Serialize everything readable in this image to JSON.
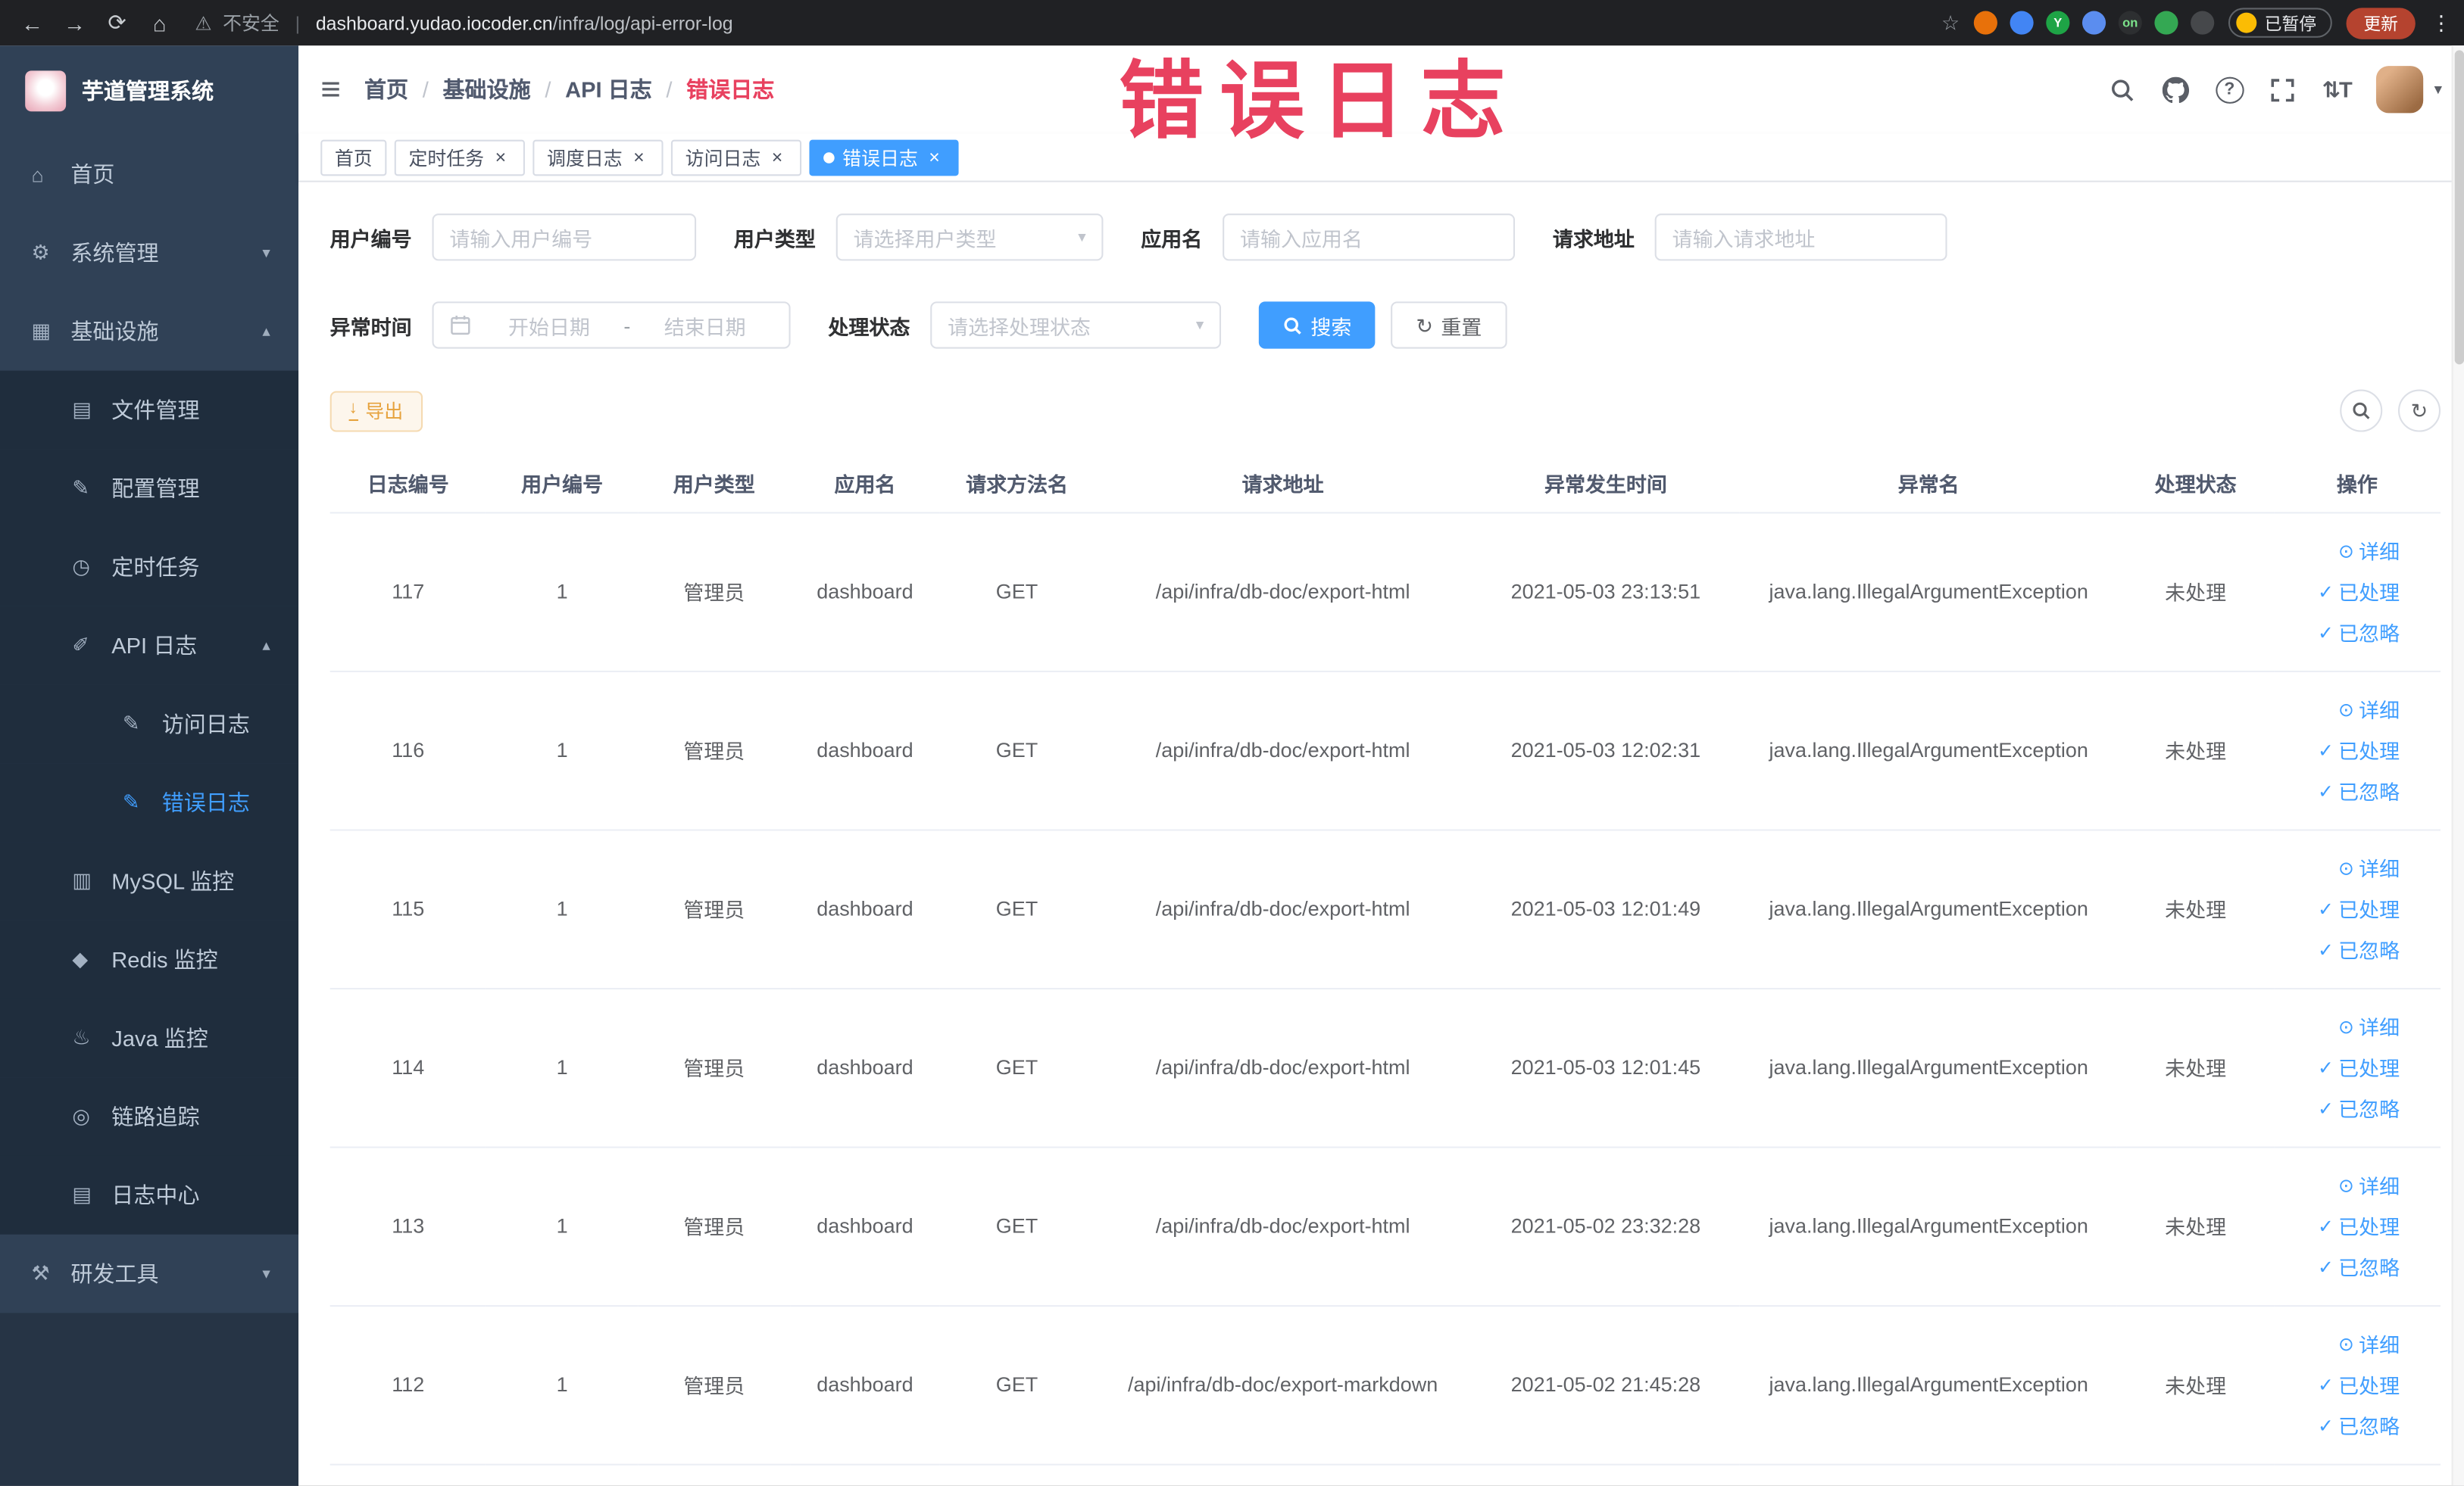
{
  "accent_color": "#409eff",
  "annotation": {
    "text": "错误日志",
    "color": "#e8415f"
  },
  "browser": {
    "security_warning": "不安全",
    "url_domain": "dashboard.yudao.iocoder.cn",
    "url_path": "/infra/log/api-error-log",
    "paused_badge": "已暂停",
    "update_button": "更新",
    "update_button_color": "#b5432f",
    "extensions": [
      {
        "name": "extension-orange-icon",
        "bg": "#e8710a",
        "label": ""
      },
      {
        "name": "extension-blue-icon",
        "bg": "#4285f4",
        "label": ""
      },
      {
        "name": "extension-green-y-icon",
        "bg": "#1ea446",
        "label": "Y"
      },
      {
        "name": "extension-grid-icon",
        "bg": "#5b8def",
        "label": ""
      },
      {
        "name": "extension-on-icon",
        "bg": "#2d2f31",
        "label": "on",
        "label_color": "#7ce38b"
      },
      {
        "name": "extension-leaf-icon",
        "bg": "#34a853",
        "label": ""
      },
      {
        "name": "extension-paw-icon",
        "bg": "#46484b",
        "label": ""
      }
    ]
  },
  "sidebar": {
    "logo_title": "芋道管理系统",
    "items": [
      {
        "id": "home",
        "label": "首页",
        "icon": "home-icon",
        "level": 1
      },
      {
        "id": "system",
        "label": "系统管理",
        "icon": "gear-icon",
        "level": 1,
        "chevron": "down"
      },
      {
        "id": "infra",
        "label": "基础设施",
        "icon": "infra-icon",
        "level": 1,
        "chevron": "up"
      },
      {
        "id": "file",
        "label": "文件管理",
        "icon": "file-icon",
        "level": 2,
        "sub": true
      },
      {
        "id": "config",
        "label": "配置管理",
        "icon": "config-icon",
        "level": 2,
        "sub": true
      },
      {
        "id": "job",
        "label": "定时任务",
        "icon": "timer-icon",
        "level": 2,
        "sub": true
      },
      {
        "id": "api-log",
        "label": "API 日志",
        "icon": "api-log-icon",
        "level": 2,
        "sub": true,
        "chevron": "up"
      },
      {
        "id": "access-log",
        "label": "访问日志",
        "icon": "access-log-icon",
        "level": 3,
        "sub": true
      },
      {
        "id": "error-log",
        "label": "错误日志",
        "icon": "error-log-icon",
        "level": 3,
        "sub": true,
        "active": true
      },
      {
        "id": "mysql",
        "label": "MySQL 监控",
        "icon": "mysql-icon",
        "level": 2,
        "sub": true
      },
      {
        "id": "redis",
        "label": "Redis 监控",
        "icon": "redis-icon",
        "level": 2,
        "sub": true
      },
      {
        "id": "java",
        "label": "Java 监控",
        "icon": "java-icon",
        "level": 2,
        "sub": true
      },
      {
        "id": "trace",
        "label": "链路追踪",
        "icon": "trace-icon",
        "level": 2,
        "sub": true
      },
      {
        "id": "log-center",
        "label": "日志中心",
        "icon": "log-center-icon",
        "level": 2,
        "sub": true
      },
      {
        "id": "dev-tools",
        "label": "研发工具",
        "icon": "tools-icon",
        "level": 1,
        "chevron": "down"
      }
    ]
  },
  "header": {
    "breadcrumb": [
      "首页",
      "基础设施",
      "API 日志",
      "错误日志"
    ]
  },
  "tags_view": [
    {
      "label": "首页",
      "closable": false,
      "active": false
    },
    {
      "label": "定时任务",
      "closable": true,
      "active": false
    },
    {
      "label": "调度日志",
      "closable": true,
      "active": false
    },
    {
      "label": "访问日志",
      "closable": true,
      "active": false
    },
    {
      "label": "错误日志",
      "closable": true,
      "active": true
    }
  ],
  "filters": {
    "user_id_label": "用户编号",
    "user_id_placeholder": "请输入用户编号",
    "user_type_label": "用户类型",
    "user_type_placeholder": "请选择用户类型",
    "app_name_label": "应用名",
    "app_name_placeholder": "请输入应用名",
    "request_url_label": "请求地址",
    "request_url_placeholder": "请输入请求地址",
    "exception_time_label": "异常时间",
    "start_date_placeholder": "开始日期",
    "range_separator": "-",
    "end_date_placeholder": "结束日期",
    "process_status_label": "处理状态",
    "process_status_placeholder": "请选择处理状态",
    "search_button": "搜索",
    "reset_button": "重置"
  },
  "toolbar": {
    "export_label": "导出"
  },
  "table": {
    "headers": [
      "日志编号",
      "用户编号",
      "用户类型",
      "应用名",
      "请求方法名",
      "请求地址",
      "异常发生时间",
      "异常名",
      "处理状态",
      "操作"
    ],
    "fields": [
      "log_id",
      "user_id",
      "user_type",
      "app_name",
      "request_method",
      "request_url",
      "exception_time",
      "exception_name",
      "process_status"
    ],
    "actions": [
      {
        "id": "detail",
        "label": "详细",
        "icon": "eye-icon"
      },
      {
        "id": "processed",
        "label": "已处理",
        "icon": "check-icon"
      },
      {
        "id": "ignored",
        "label": "已忽略",
        "icon": "check-icon"
      }
    ],
    "rows": [
      {
        "log_id": "117",
        "user_id": "1",
        "user_type": "管理员",
        "app_name": "dashboard",
        "request_method": "GET",
        "request_url": "/api/infra/db-doc/export-html",
        "exception_time": "2021-05-03 23:13:51",
        "exception_name": "java.lang.IllegalArgumentException",
        "process_status": "未处理"
      },
      {
        "log_id": "116",
        "user_id": "1",
        "user_type": "管理员",
        "app_name": "dashboard",
        "request_method": "GET",
        "request_url": "/api/infra/db-doc/export-html",
        "exception_time": "2021-05-03 12:02:31",
        "exception_name": "java.lang.IllegalArgumentException",
        "process_status": "未处理"
      },
      {
        "log_id": "115",
        "user_id": "1",
        "user_type": "管理员",
        "app_name": "dashboard",
        "request_method": "GET",
        "request_url": "/api/infra/db-doc/export-html",
        "exception_time": "2021-05-03 12:01:49",
        "exception_name": "java.lang.IllegalArgumentException",
        "process_status": "未处理"
      },
      {
        "log_id": "114",
        "user_id": "1",
        "user_type": "管理员",
        "app_name": "dashboard",
        "request_method": "GET",
        "request_url": "/api/infra/db-doc/export-html",
        "exception_time": "2021-05-03 12:01:45",
        "exception_name": "java.lang.IllegalArgumentException",
        "process_status": "未处理"
      },
      {
        "log_id": "113",
        "user_id": "1",
        "user_type": "管理员",
        "app_name": "dashboard",
        "request_method": "GET",
        "request_url": "/api/infra/db-doc/export-html",
        "exception_time": "2021-05-02 23:32:28",
        "exception_name": "java.lang.IllegalArgumentException",
        "process_status": "未处理"
      },
      {
        "log_id": "112",
        "user_id": "1",
        "user_type": "管理员",
        "app_name": "dashboard",
        "request_method": "GET",
        "request_url": "/api/infra/db-doc/export-markdown",
        "exception_time": "2021-05-02 21:45:28",
        "exception_name": "java.lang.IllegalArgumentException",
        "process_status": "未处理"
      }
    ]
  }
}
